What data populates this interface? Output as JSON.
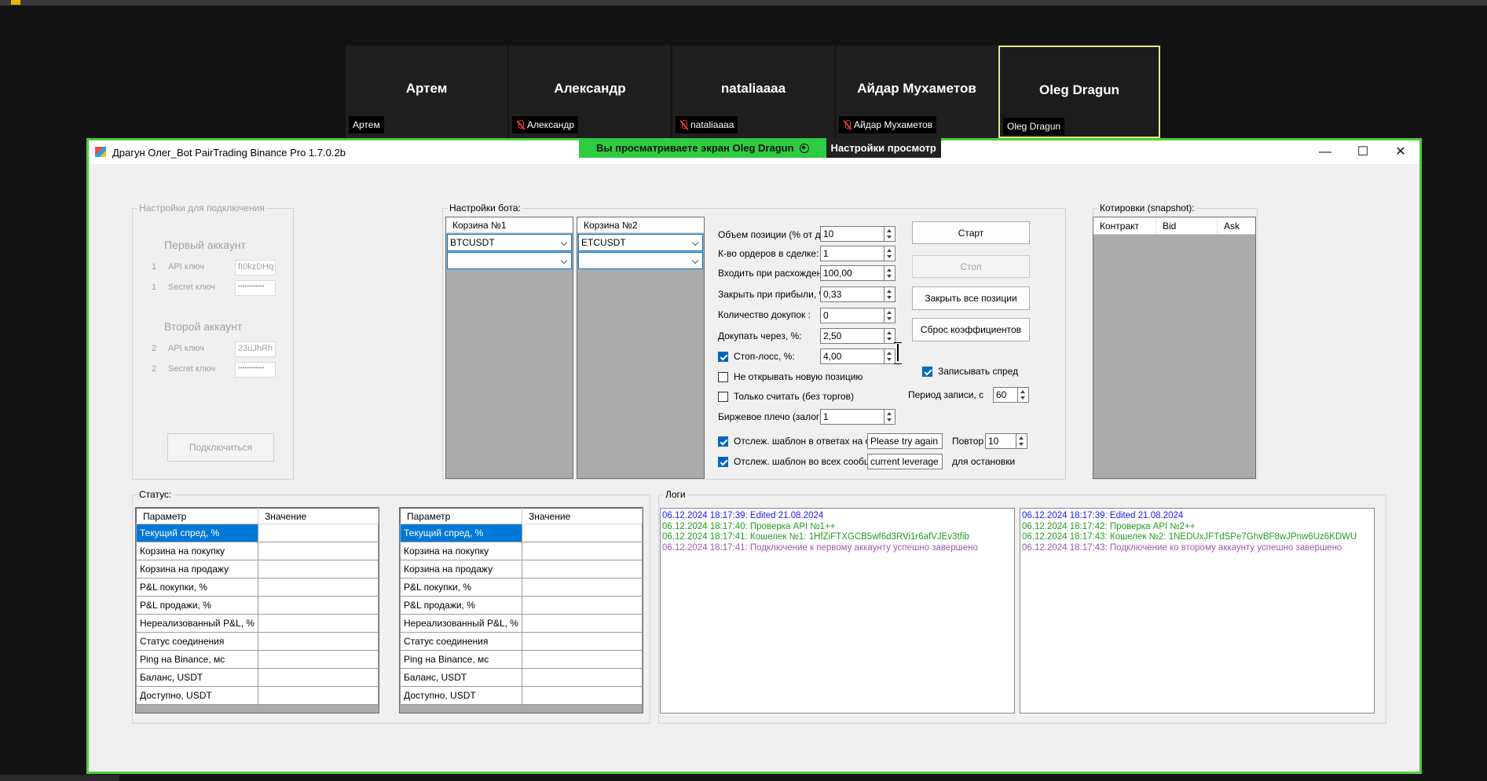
{
  "participants": [
    {
      "name": "Артем",
      "label": "Артем",
      "muted": false,
      "active": false
    },
    {
      "name": "Александр",
      "label": "Александр",
      "muted": true,
      "active": false
    },
    {
      "name": "nataliaaaa",
      "label": "nataliaaaa",
      "muted": true,
      "active": false
    },
    {
      "name": "Айдар Мухаметов",
      "label": "Айдар Мухаметов",
      "muted": true,
      "active": false
    },
    {
      "name": "Oleg Dragun",
      "label": "Oleg Dragun",
      "muted": false,
      "active": true
    }
  ],
  "share": {
    "banner": "Вы просматриваете экран  Oleg Dragun",
    "settings": "Настройки просмотр"
  },
  "window": {
    "title": "Драгун Олег_Bot PairTrading Binance Pro 1.7.0.2b",
    "minimize": "—",
    "maximize": "☐",
    "close": "✕"
  },
  "connection": {
    "title": "Настройки для подключения",
    "first_account": "Первый аккаунт",
    "first_api_num": "1",
    "first_api_label": "API ключ",
    "first_api_value": "fI0kzDHq",
    "first_secret_num": "1",
    "first_secret_label": "Secret ключ",
    "first_secret_value": "••••••••••••",
    "second_account": "Второй аккаунт",
    "second_api_num": "2",
    "second_api_label": "API ключ",
    "second_api_value": "23uJhRh",
    "second_secret_num": "2",
    "second_secret_label": "Secret ключ",
    "second_secret_value": "••••••••••••",
    "connect_button": "Подключиться"
  },
  "bot": {
    "title": "Настройки бота:",
    "basket1": {
      "header": "Корзина №1",
      "combo1": "BTCUSDT",
      "combo2": ""
    },
    "basket2": {
      "header": "Корзина №2",
      "combo1": "ETCUSDT",
      "combo2": ""
    },
    "position_volume_label": "Объем позиции (% от депо):",
    "position_volume": "10",
    "orders_count_label": "К-во ордеров в сделке:",
    "orders_count": "1",
    "enter_divergence_label": "Входить при расхождении, %:",
    "enter_divergence": "100,00",
    "take_profit_label": "Закрыть при прибыли, %:",
    "take_profit": "0,33",
    "add_count_label": "Количество докупок :",
    "add_count": "0",
    "add_step_label": "Докупать через, %:",
    "add_step": "2,50",
    "stop_loss_label": "Стоп-лосс, %:",
    "stop_loss": "4,00",
    "stop_loss_checked": true,
    "no_new_position_label": "Не открывать новую позицию",
    "no_new_position_checked": false,
    "only_count_label": "Только считать (без торгов)",
    "only_count_checked": false,
    "leverage_label": "Биржевое плечо (залог):",
    "leverage": "1",
    "start_button": "Старт",
    "stop_button": "Стоп",
    "close_all_button": "Закрыть все позиции",
    "reset_coef_button": "Сброс коэффициентов",
    "record_spread_label": "Записывать спред",
    "record_spread_checked": true,
    "record_period_label": "Период записи, с",
    "record_period": "60",
    "track_orders_label": "Отслеж. шаблон в ответах на ордера",
    "track_orders_checked": true,
    "track_orders_value": "Please try again",
    "repeat_label": "Повтор",
    "repeat_value": "10",
    "track_all_label": "Отслеж. шаблон во всех сообщениях",
    "track_all_checked": true,
    "track_all_value": "current leverage",
    "for_stop_label": "для остановки"
  },
  "quotes": {
    "title": "Котировки (snapshot):",
    "columns": [
      "Контракт",
      "Bid",
      "Ask"
    ]
  },
  "status": {
    "title": "Статус:",
    "columns": [
      "Параметр",
      "Значение"
    ],
    "rows": [
      "Текущий спред, %",
      "Корзина на покупку",
      "Корзина на продажу",
      "P&L покупки, %",
      "P&L продажи, %",
      "Нереализованный P&L, %",
      "Статус соединения",
      "Ping на Binance, мс",
      "Баланс, USDT",
      "Доступно, USDT"
    ]
  },
  "logs": {
    "title": "Логи",
    "left": [
      {
        "text": "06.12.2024 18:17:39: Edited 21.08.2024",
        "color": "#1a1aff"
      },
      {
        "text": "06.12.2024 18:17:40: Проверка API №1++",
        "color": "#1f9e1f"
      },
      {
        "text": "06.12.2024 18:17:41: Кошелек №1: 1HfZiFTXGCB5wf6d3RVi1r6afVJEv3tfib",
        "color": "#1f9e1f"
      },
      {
        "text": "06.12.2024 18:17:41: Подключение к первому аккаунту успешно завершено",
        "color": "#9b59b6"
      }
    ],
    "right": [
      {
        "text": "06.12.2024 18:17:39: Edited 21.08.2024",
        "color": "#1a1aff"
      },
      {
        "text": "06.12.2024 18:17:42: Проверка API №2++",
        "color": "#1f9e1f"
      },
      {
        "text": "06.12.2024 18:17:43: Кошелек №2: 1NEDUxJFTdSPe7GhvBF8wJPnw6Uz6KDWU",
        "color": "#1f9e1f"
      },
      {
        "text": "06.12.2024 18:17:43: Подключение ко второму аккаунту успешно завершено",
        "color": "#9b59b6"
      }
    ]
  },
  "colors": {
    "accent": "#0078d7",
    "share_border": "#4cd137",
    "active_tile": "#e9e986"
  }
}
